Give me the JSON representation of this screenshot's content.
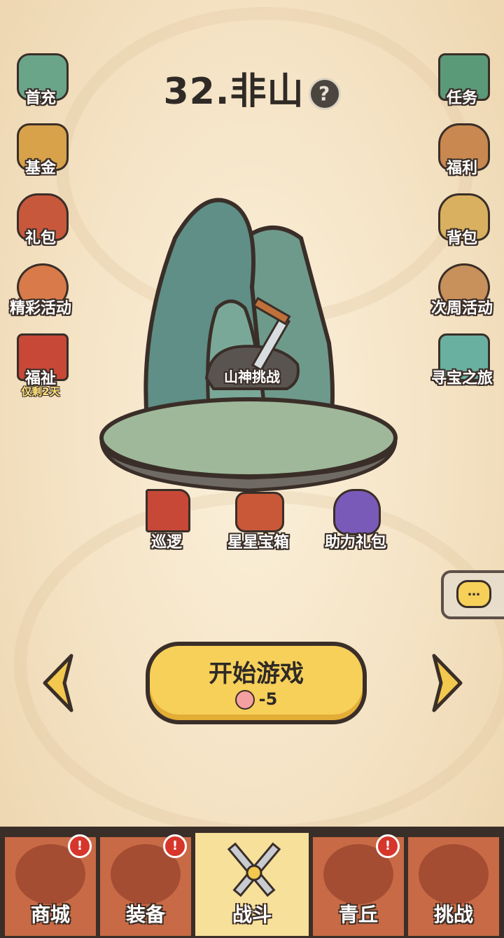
{
  "title": "32.非山",
  "help_icon": "question-mark-icon",
  "left_buttons": [
    {
      "label": "首充",
      "icon": "first-recharge-icon",
      "color": "#6aa58a"
    },
    {
      "label": "基金",
      "icon": "fund-book-icon",
      "color": "#d8a24a"
    },
    {
      "label": "礼包",
      "icon": "gift-bag-icon",
      "color": "#c8583c"
    },
    {
      "label": "精彩活动",
      "icon": "koi-fish-icon",
      "color": "#d87a4a"
    },
    {
      "label": "福祉",
      "sub": "仅剩2天",
      "icon": "gift-box-icon",
      "color": "#c84838"
    }
  ],
  "right_buttons": [
    {
      "label": "任务",
      "icon": "scroll-icon",
      "color": "#5a9a78"
    },
    {
      "label": "福利",
      "icon": "lucky-bag-icon",
      "color": "#c88850"
    },
    {
      "label": "背包",
      "icon": "backpack-icon",
      "color": "#d8b060"
    },
    {
      "label": "次周活动",
      "icon": "drum-icon",
      "color": "#c8905a"
    },
    {
      "label": "寻宝之旅",
      "icon": "treasure-chest-icon",
      "color": "#6ab0a0"
    }
  ],
  "stage": {
    "boss_label": "山神挑战",
    "items": [
      {
        "label": "巡逻",
        "icon": "banner-flag-icon"
      },
      {
        "label": "星星宝箱",
        "icon": "star-chest-icon"
      },
      {
        "label": "助力礼包",
        "icon": "purple-bag-icon"
      }
    ]
  },
  "start_button": {
    "label": "开始游戏",
    "cost": "-5",
    "cost_icon": "peach-icon"
  },
  "tabs": [
    {
      "label": "商城",
      "icon": "shop-icon",
      "badge": "!",
      "active": false
    },
    {
      "label": "装备",
      "icon": "armor-icon",
      "badge": "!",
      "active": false
    },
    {
      "label": "战斗",
      "icon": "crossed-swords-icon",
      "badge": "",
      "active": true
    },
    {
      "label": "青丘",
      "icon": "mountain-icon",
      "badge": "!",
      "active": false
    },
    {
      "label": "挑战",
      "icon": "orb-icon",
      "badge": "",
      "active": false
    }
  ],
  "colors": {
    "accent": "#f7d05a",
    "tab": "#c86a45",
    "tab_active": "#f6e09a",
    "outline": "#3a2e28"
  }
}
